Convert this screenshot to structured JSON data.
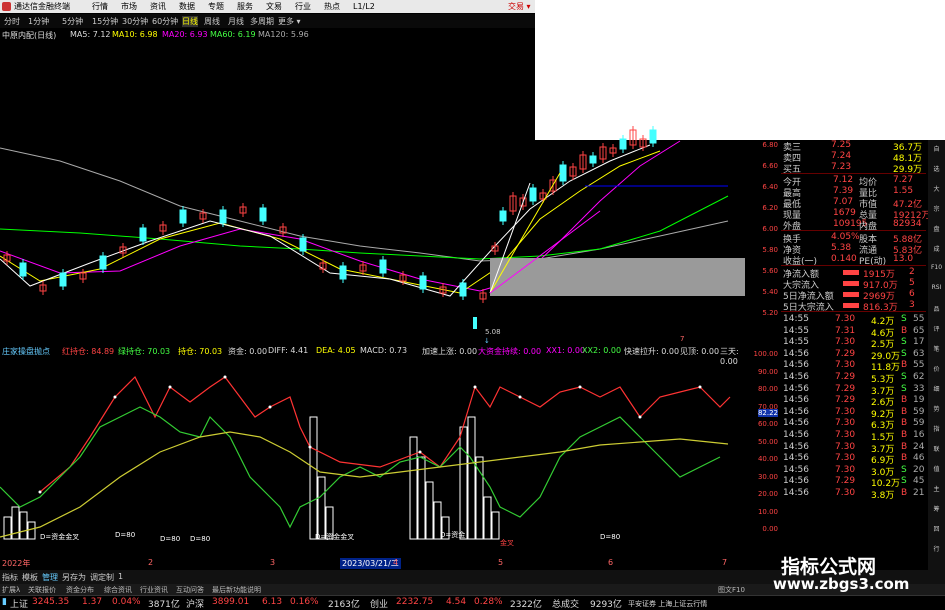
{
  "titlebar": {
    "title": "通达信金融终端",
    "menu": [
      "行情",
      "市场",
      "资讯",
      "数据",
      "专题",
      "服务",
      "文易",
      "行业",
      "热点",
      "L1/L2"
    ],
    "trade": "交易 ▾"
  },
  "periods": [
    "分时",
    "1分钟",
    "5分钟",
    "15分钟",
    "30分钟",
    "60分钟",
    "日线",
    "周线",
    "月线",
    "多周期",
    "更多 ▾"
  ],
  "ma": {
    "name": "中原内配(日线)",
    "ma5": "MA5: 7.12",
    "ma10": "MA10: 6.98",
    "ma20": "MA20: 6.93",
    "ma60": "MA60: 6.19",
    "ma120": "MA120: 5.96"
  },
  "indicator": {
    "name": "庄家操盘抛点",
    "items": [
      "红持仓: 84.89",
      "绿持仓: 70.03",
      "持仓: 70.03",
      "资金: 0.00",
      "DIFF: 4.41",
      "DEA: 4.05",
      "MACD: 0.73",
      "加速上涨: 0.00",
      "大资金持续: 0.00",
      "XX1: 0.00",
      "XX2: 0.00",
      "快速拉升: 0.00",
      "见顶: 0.00",
      "三天: 0.00"
    ]
  },
  "price_scale": [
    "6.80",
    "6.60",
    "6.40",
    "6.20",
    "6.00",
    "5.80",
    "5.60",
    "5.40",
    "5.20"
  ],
  "ind_scale": [
    "100.00",
    "90.00",
    "80.00",
    "70.00",
    "60.00",
    "50.00",
    "40.00",
    "30.00",
    "20.00",
    "10.00",
    "0.00"
  ],
  "ind_scale_tag": "82.22",
  "chart_labels": {
    "low": "5.08",
    "high_marker": "7",
    "d_labels": [
      "D=80",
      "D=80",
      "D=80",
      "D=80"
    ],
    "cross": [
      "D=资金金叉",
      "D=资金金叉",
      "D=资金",
      "金叉"
    ],
    "date_box": "2023/03/21/二",
    "years": [
      "2022年",
      "2",
      "3",
      "4",
      "5",
      "6",
      "7"
    ]
  },
  "quote": {
    "top": [
      [
        "卖三",
        "7.25",
        "36.7万"
      ],
      [
        "卖四",
        "7.24",
        "48.1万"
      ],
      [
        "买五",
        "7.23",
        "29.9万"
      ]
    ],
    "stats": [
      [
        "今开",
        "7.12",
        "均价",
        "7.27"
      ],
      [
        "最高",
        "7.39",
        "量比",
        "1.55"
      ],
      [
        "最低",
        "7.07",
        "市值",
        "47.2亿"
      ],
      [
        "现量",
        "1679",
        "总量",
        "19212万"
      ],
      [
        "外盘",
        "109195",
        "内盘",
        "82934"
      ]
    ],
    "stats2": [
      [
        "换手",
        "4.05%",
        "股本",
        "5.88亿"
      ],
      [
        "净资",
        "5.38",
        "流通",
        "5.83亿"
      ],
      [
        "收益(一)",
        "0.140",
        "PE(动)",
        "13.0"
      ]
    ],
    "flow": [
      [
        "净流入额",
        "1915万",
        "2"
      ],
      [
        "大宗流入",
        "917.0万",
        "5"
      ],
      [
        "5日净流入额",
        "2969万",
        "6"
      ],
      [
        "5日大宗流入",
        "816.3万",
        "3"
      ]
    ]
  },
  "ticks": [
    [
      "14:55",
      "7.30",
      "4.2万",
      "S",
      "55"
    ],
    [
      "14:55",
      "7.31",
      "4.6万",
      "B",
      "65"
    ],
    [
      "14:55",
      "7.30",
      "2.5万",
      "S",
      "17"
    ],
    [
      "14:56",
      "7.29",
      "29.0万",
      "S",
      "63"
    ],
    [
      "14:56",
      "7.30",
      "11.8万",
      "B",
      "55"
    ],
    [
      "14:56",
      "7.29",
      "5.3万",
      "S",
      "62"
    ],
    [
      "14:56",
      "7.29",
      "3.7万",
      "S",
      "33"
    ],
    [
      "14:56",
      "7.29",
      "2.6万",
      "B",
      "19"
    ],
    [
      "14:56",
      "7.30",
      "9.2万",
      "B",
      "59"
    ],
    [
      "14:56",
      "7.30",
      "6.3万",
      "B",
      "59"
    ],
    [
      "14:56",
      "7.30",
      "1.5万",
      "B",
      "16"
    ],
    [
      "14:56",
      "7.30",
      "3.7万",
      "B",
      "24"
    ],
    [
      "14:56",
      "7.30",
      "6.9万",
      "B",
      "46"
    ],
    [
      "14:56",
      "7.30",
      "3.0万",
      "S",
      "20"
    ],
    [
      "14:56",
      "7.29",
      "10.2万",
      "S",
      "45"
    ],
    [
      "14:56",
      "7.30",
      "3.8万",
      "B",
      "21"
    ]
  ],
  "right_tabs": [
    "自",
    "选",
    "大",
    "宗",
    "盘",
    "成",
    "F10",
    "RSI",
    "品",
    "评",
    "笔",
    "价",
    "细",
    "势",
    "指",
    "联",
    "值",
    "主",
    "筹",
    "回",
    "行"
  ],
  "bottom_tabs": [
    "指标",
    "模板",
    "管理",
    "另存为",
    "调定制",
    "1"
  ],
  "fn_tabs": [
    "扩展λ",
    "关联报价",
    "资金分布",
    "综合资讯",
    "行业资讯",
    "互动问答",
    "最后新功能说明",
    "图文F10"
  ],
  "status": {
    "sh_name": "上证",
    "sh_val": "3245.35",
    "sh_chg": "1.37",
    "sh_pct": "0.04%",
    "sh_amt": "3871亿",
    "sz_name": "沪深",
    "sz_val": "3899.01",
    "sz_chg": "6.13",
    "sz_pct": "0.16%",
    "sz_amt": "2163亿",
    "cy_name": "创业",
    "cy_val": "2232.75",
    "cy_chg": "4.54",
    "cy_pct": "0.28%",
    "cy_amt": "2322亿",
    "total_name": "总成交",
    "total_amt": "9293亿",
    "broker": "平安证券 上海上证云行情"
  },
  "watermark": {
    "line1": "指标公式网",
    "line2": "www.zbgs3.com"
  },
  "colors": {
    "up": "#ff4444",
    "down": "#44ff44",
    "ma5": "#ffffff",
    "ma10": "#ffff00",
    "ma20": "#ff00ff",
    "ma60": "#00ff00",
    "ma120": "#aaaaaa"
  },
  "chart_data": [
    {
      "type": "candlestick",
      "x_range": [
        "2022",
        "2023-07"
      ],
      "ylim": [
        5.08,
        6.8
      ],
      "low_marker": 5.08,
      "series": [
        {
          "name": "MA5"
        },
        {
          "name": "MA10"
        },
        {
          "name": "MA20"
        },
        {
          "name": "MA60"
        },
        {
          "name": "MA120"
        }
      ]
    },
    {
      "type": "line",
      "ylim": [
        0,
        100
      ],
      "series": [
        {
          "name": "红持仓",
          "last": 84.89
        },
        {
          "name": "绿持仓",
          "last": 70.03
        }
      ]
    }
  ]
}
